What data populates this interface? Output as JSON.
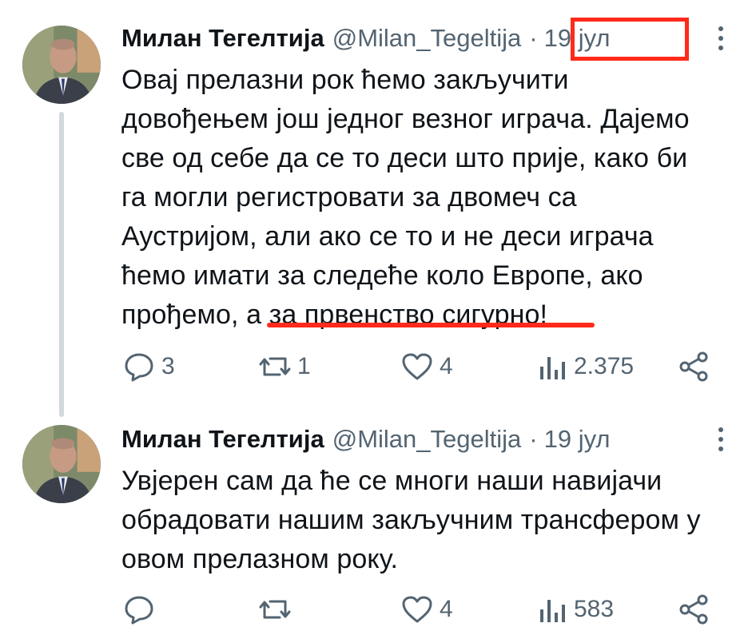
{
  "tweets": [
    {
      "author": "Милан Тегелтија",
      "handle": "@Milan_Tegeltija",
      "separator": "·",
      "time": "19 јул",
      "text": "Овај прелазни рок  ћемо закључити\nдовођењем још једног везног играча. Дајемо\nсве од себе да се то деси што прије, како би\nга могли регистровати за двомеч са\nАустријом, али ако се то и не деси играча\nћемо имати за следеће коло Европе, ако\nпрођемо, а за првенство сигурно!",
      "replies": "3",
      "retweets": "1",
      "likes": "4",
      "views": "2.375"
    },
    {
      "author": "Милан Тегелтија",
      "handle": "@Milan_Tegeltija",
      "separator": "·",
      "time": "19 јул",
      "text": "Увјерен сам да ће се многи наши навијачи\nобрадовати нашим закључним трансфером у\nовом прелазном року.",
      "replies": "",
      "retweets": "",
      "likes": "4",
      "views": "583"
    }
  ],
  "colors": {
    "text": "#0f1419",
    "secondary": "#536471",
    "annotation": "#ff2a1a",
    "thread_line": "#cfd9de"
  },
  "icons": [
    "reply-icon",
    "retweet-icon",
    "like-icon",
    "views-icon",
    "share-icon",
    "more-icon"
  ]
}
